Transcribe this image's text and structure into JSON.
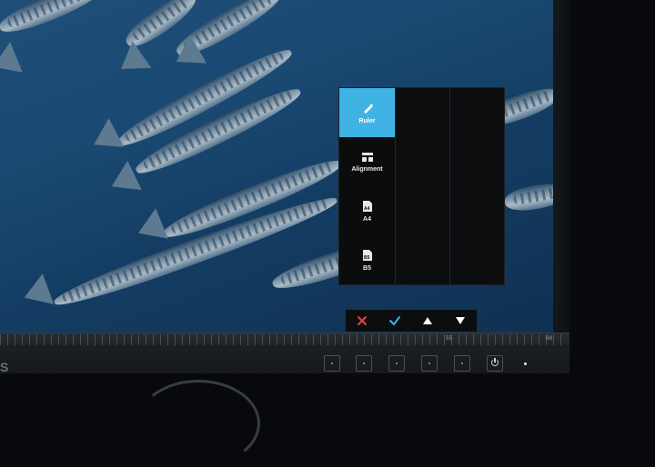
{
  "osd": {
    "items": [
      {
        "label": "Ruler",
        "icon": "ruler-icon",
        "active": true
      },
      {
        "label": "Alignment",
        "icon": "alignment-icon",
        "active": false
      },
      {
        "label": "A4",
        "icon": "a4-page-icon",
        "active": false
      },
      {
        "label": "B5",
        "icon": "b5-page-icon",
        "active": false
      }
    ],
    "nav": [
      "close-icon",
      "check-icon",
      "up-arrow-icon",
      "down-arrow-icon"
    ],
    "accent": "#3fb3e3",
    "close_color": "#e5433e",
    "check_color": "#3fb3e3"
  },
  "bezel": {
    "ruler_numbers": [
      "55",
      "60"
    ],
    "logo_fragment": "S"
  }
}
